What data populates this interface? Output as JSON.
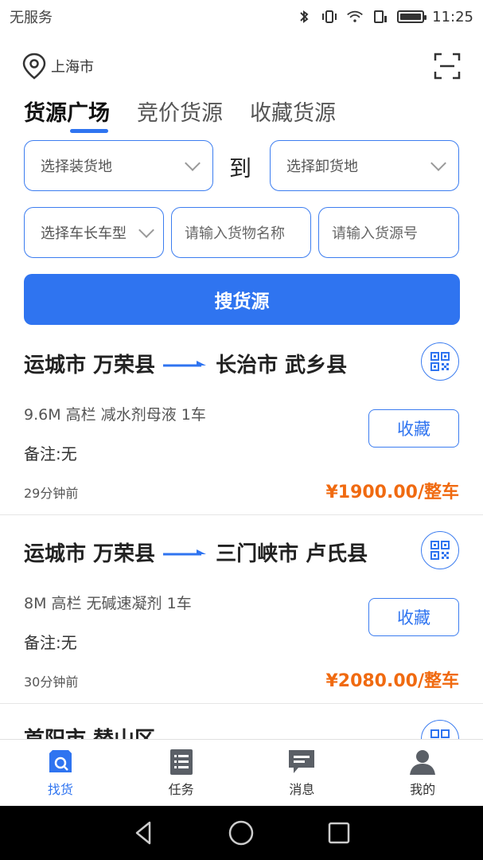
{
  "status_bar": {
    "carrier": "无服务",
    "time": "11:25"
  },
  "header": {
    "location": "上海市"
  },
  "tabs": [
    {
      "label": "货源广场",
      "active": true
    },
    {
      "label": "竞价货源",
      "active": false
    },
    {
      "label": "收藏货源",
      "active": false
    }
  ],
  "filters": {
    "load_placeholder": "选择装货地",
    "to_label": "到",
    "unload_placeholder": "选择卸货地",
    "vehicle_placeholder": "选择车长车型",
    "cargo_name_placeholder": "请输入货物名称",
    "cargo_no_placeholder": "请输入货源号"
  },
  "search_button": "搜货源",
  "listings": [
    {
      "from": "运城市 万荣县",
      "to": "长治市 武乡县",
      "cargo": "9.6M 高栏 减水剂母液 1车",
      "remark_label": "备注:",
      "remark_value": "无",
      "time": "29分钟前",
      "fav_label": "收藏",
      "price": "¥1900.00/整车"
    },
    {
      "from": "运城市 万荣县",
      "to": "三门峡市 卢氏县",
      "cargo": "8M 高栏 无碱速凝剂 1车",
      "remark_label": "备注:",
      "remark_value": "无",
      "time": "30分钟前",
      "fav_label": "收藏",
      "price": "¥2080.00/整车"
    }
  ],
  "partial_listing": {
    "from": "首阳市 替山区"
  },
  "bottom_nav": [
    {
      "label": "找货",
      "icon": "find-cargo-icon",
      "active": true
    },
    {
      "label": "任务",
      "icon": "task-list-icon",
      "active": false
    },
    {
      "label": "消息",
      "icon": "message-icon",
      "active": false
    },
    {
      "label": "我的",
      "icon": "profile-icon",
      "active": false
    }
  ],
  "colors": {
    "accent": "#2f74f0",
    "price": "#f06a10"
  }
}
